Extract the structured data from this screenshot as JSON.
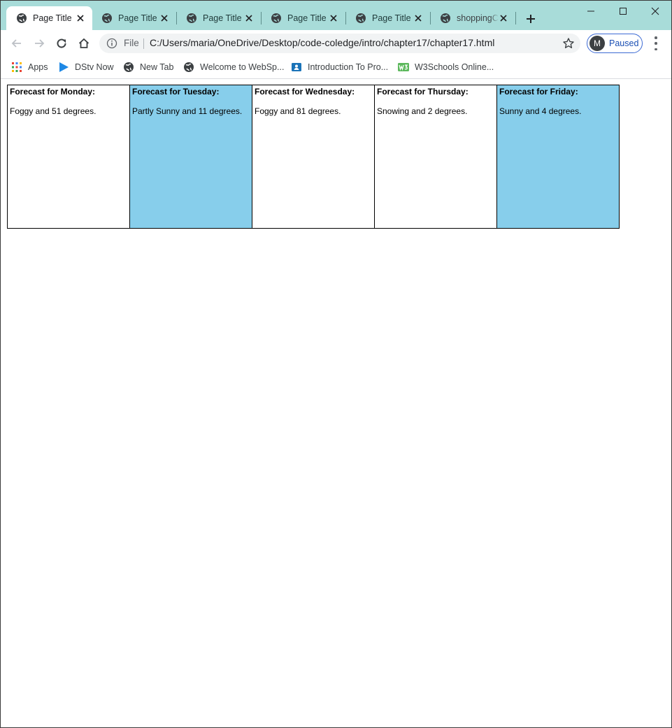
{
  "window": {
    "tabs": [
      {
        "title": "Page Title",
        "active": true
      },
      {
        "title": "Page Title",
        "active": false
      },
      {
        "title": "Page Title",
        "active": false
      },
      {
        "title": "Page Title",
        "active": false
      },
      {
        "title": "Page Title",
        "active": false
      },
      {
        "title": "shoppingC",
        "active": false
      }
    ],
    "new_tab_icon": "plus-icon",
    "controls": [
      "minimize-icon",
      "maximize-icon",
      "close-icon"
    ]
  },
  "toolbar": {
    "back_icon": "arrow-left-icon",
    "forward_icon": "arrow-right-icon",
    "reload_icon": "reload-icon",
    "home_icon": "home-icon",
    "scheme_label": "File",
    "url": "C:/Users/maria/OneDrive/Desktop/code-coledge/intro/chapter17/chapter17.html",
    "profile_initial": "M",
    "profile_status": "Paused"
  },
  "bookmarks": [
    {
      "label": "Apps",
      "icon": "apps-grid-icon"
    },
    {
      "label": "DStv Now",
      "icon": "play-icon"
    },
    {
      "label": "New Tab",
      "icon": "globe-icon"
    },
    {
      "label": "Welcome to WebSp...",
      "icon": "globe-icon"
    },
    {
      "label": "Introduction To Pro...",
      "icon": "classroom-icon"
    },
    {
      "label": "W3Schools Online...",
      "icon": "w3-icon"
    }
  ],
  "forecasts": [
    {
      "heading": "Forecast for Monday:",
      "text": "Foggy and 51 degrees.",
      "highlighted": false
    },
    {
      "heading": "Forecast for Tuesday:",
      "text": "Partly Sunny and 11 degrees.",
      "highlighted": true
    },
    {
      "heading": "Forecast for Wednesday:",
      "text": "Foggy and 81 degrees.",
      "highlighted": false
    },
    {
      "heading": "Forecast for Thursday:",
      "text": "Snowing and 2 degrees.",
      "highlighted": false
    },
    {
      "heading": "Forecast for Friday:",
      "text": "Sunny and 4 degrees.",
      "highlighted": true
    }
  ],
  "colors": {
    "tab_strip": "#a8dcd9",
    "highlight_card": "#87ceeb",
    "profile_accent": "#1a4fb4"
  }
}
